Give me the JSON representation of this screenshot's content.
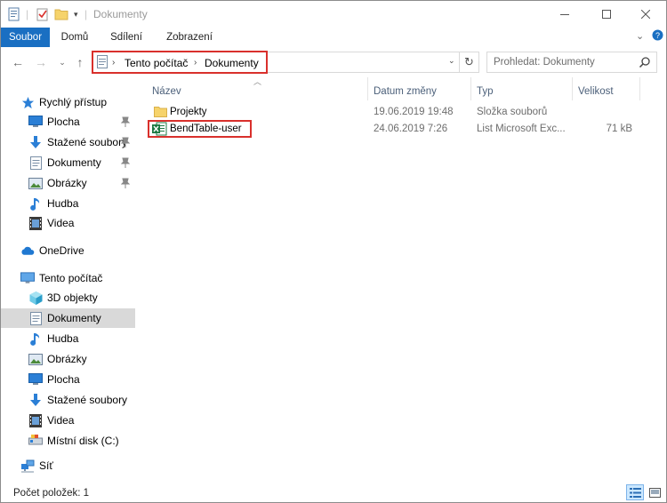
{
  "window": {
    "title": "Dokumenty"
  },
  "ribbon": {
    "tabs": [
      "Soubor",
      "Domů",
      "Sdílení",
      "Zobrazení"
    ]
  },
  "address": {
    "crumbs": [
      "Tento počítač",
      "Dokumenty"
    ]
  },
  "search": {
    "placeholder": "Prohledat: Dokumenty"
  },
  "nav": {
    "quick_access": "Rychlý přístup",
    "quick_items": [
      "Plocha",
      "Stažené soubory",
      "Dokumenty",
      "Obrázky",
      "Hudba",
      "Videa"
    ],
    "onedrive": "OneDrive",
    "this_pc": "Tento počítač",
    "pc_items": [
      "3D objekty",
      "Dokumenty",
      "Hudba",
      "Obrázky",
      "Plocha",
      "Stažené soubory",
      "Videa",
      "Místní disk (C:)"
    ],
    "network": "Síť"
  },
  "columns": [
    "Název",
    "Datum změny",
    "Typ",
    "Velikost"
  ],
  "files": [
    {
      "name": "Projekty",
      "date": "19.06.2019 19:48",
      "type": "Složka souborů",
      "size": ""
    },
    {
      "name": "BendTable-user",
      "date": "24.06.2019 7:26",
      "type": "List Microsoft Exc...",
      "size": "71 kB"
    }
  ],
  "status": {
    "text": "Počet položek: 1"
  },
  "colors": {
    "accent": "#1a6fc2",
    "highlight": "#d9302c",
    "folder": "#f6d36b",
    "excel": "#1d7a43"
  }
}
